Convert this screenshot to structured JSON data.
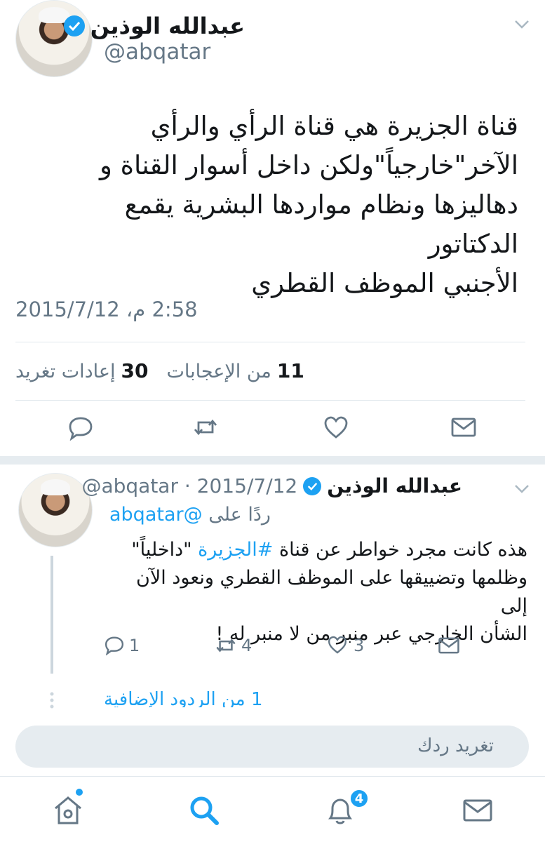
{
  "main_tweet": {
    "display_name": "عبدالله الوذين",
    "handle": "@abqatar",
    "text_lines": [
      "قناة الجزيرة هي قناة الرأي والرأي",
      "الآخر\"خارجياً\"ولكن داخل أسوار القناة و",
      "دهاليزها ونظام مواردها البشرية يقمع الدكتاتور",
      "الأجنبي الموظف القطري"
    ],
    "timestamp": "2:58 م، 2015/7/12",
    "retweets_count": "30",
    "retweets_label": "إعادات تغريد",
    "likes_count": "11",
    "likes_label": "من الإعجابات"
  },
  "reply": {
    "display_name": "عبدالله الوذين",
    "handle_date": "@abqatar · 2015/7/12",
    "replying_label": "ردًا على",
    "replying_handle": "@abqatar",
    "text_line1_pre": "هذه كانت مجرد خواطر عن قناة ",
    "text_hashtag": "#الجزيرة",
    "text_line1_post": " \"داخلياً\"",
    "text_line2": "وظلمها وتضييقها على الموظف القطري ونعود الآن إلى",
    "text_line3": "الشأن الخارجي عبر منبر من لا منبر له !",
    "reply_count": "1",
    "retweet_count": "4",
    "like_count": "3",
    "more_replies": "1 من الردود الإضافية"
  },
  "compose": {
    "placeholder": "تغريد ردك"
  },
  "tabbar": {
    "notifications_badge": "4"
  },
  "colors": {
    "accent": "#1da1f2",
    "muted": "#657786",
    "divider": "#e1e8ed"
  }
}
